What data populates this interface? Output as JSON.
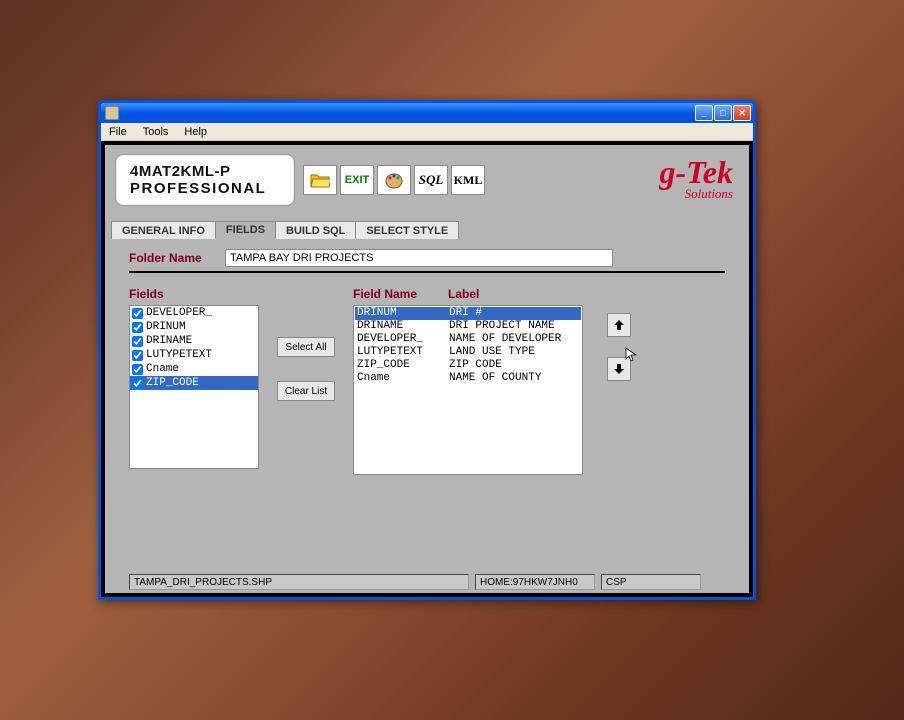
{
  "menubar": {
    "file": "File",
    "tools": "Tools",
    "help": "Help"
  },
  "logo": {
    "line1": "4MAT2KML-P",
    "line2": "PROFESSIONAL"
  },
  "toolbar": {
    "exit": "EXIT",
    "sql": "SQL",
    "kml": "KML"
  },
  "brand": {
    "main": "g-Tek",
    "sub": "Solutions"
  },
  "tabs": {
    "general": "GENERAL INFO",
    "fields": "FIELDS",
    "build": "BUILD SQL",
    "style": "SELECT STYLE"
  },
  "folder": {
    "label": "Folder Name",
    "value": "TAMPA BAY DRI PROJECTS"
  },
  "fields_header": "Fields",
  "fields_list": [
    {
      "name": "DEVELOPER_",
      "checked": true,
      "selected": false
    },
    {
      "name": "DRINUM",
      "checked": true,
      "selected": false
    },
    {
      "name": "DRINAME",
      "checked": true,
      "selected": false
    },
    {
      "name": "LUTYPETEXT",
      "checked": true,
      "selected": false
    },
    {
      "name": "Cname",
      "checked": true,
      "selected": false
    },
    {
      "name": "ZIP_CODE",
      "checked": true,
      "selected": true
    }
  ],
  "mid_buttons": {
    "select_all": "Select All",
    "clear_list": "Clear List"
  },
  "right_headers": {
    "fieldname": "Field Name",
    "label": "Label"
  },
  "right_rows": [
    {
      "field": "DRINUM",
      "label": "DRI #",
      "selected": true
    },
    {
      "field": "DRINAME",
      "label": "DRI PROJECT NAME",
      "selected": false
    },
    {
      "field": "DEVELOPER_",
      "label": "NAME OF DEVELOPER",
      "selected": false
    },
    {
      "field": "LUTYPETEXT",
      "label": "LAND USE TYPE",
      "selected": false
    },
    {
      "field": "ZIP_CODE",
      "label": "ZIP CODE",
      "selected": false
    },
    {
      "field": "Cname",
      "label": "NAME OF COUNTY",
      "selected": false
    }
  ],
  "status": {
    "file": "TAMPA_DRI_PROJECTS.SHP",
    "home": "HOME:97HKW7JNH0",
    "fmt": "CSP"
  }
}
